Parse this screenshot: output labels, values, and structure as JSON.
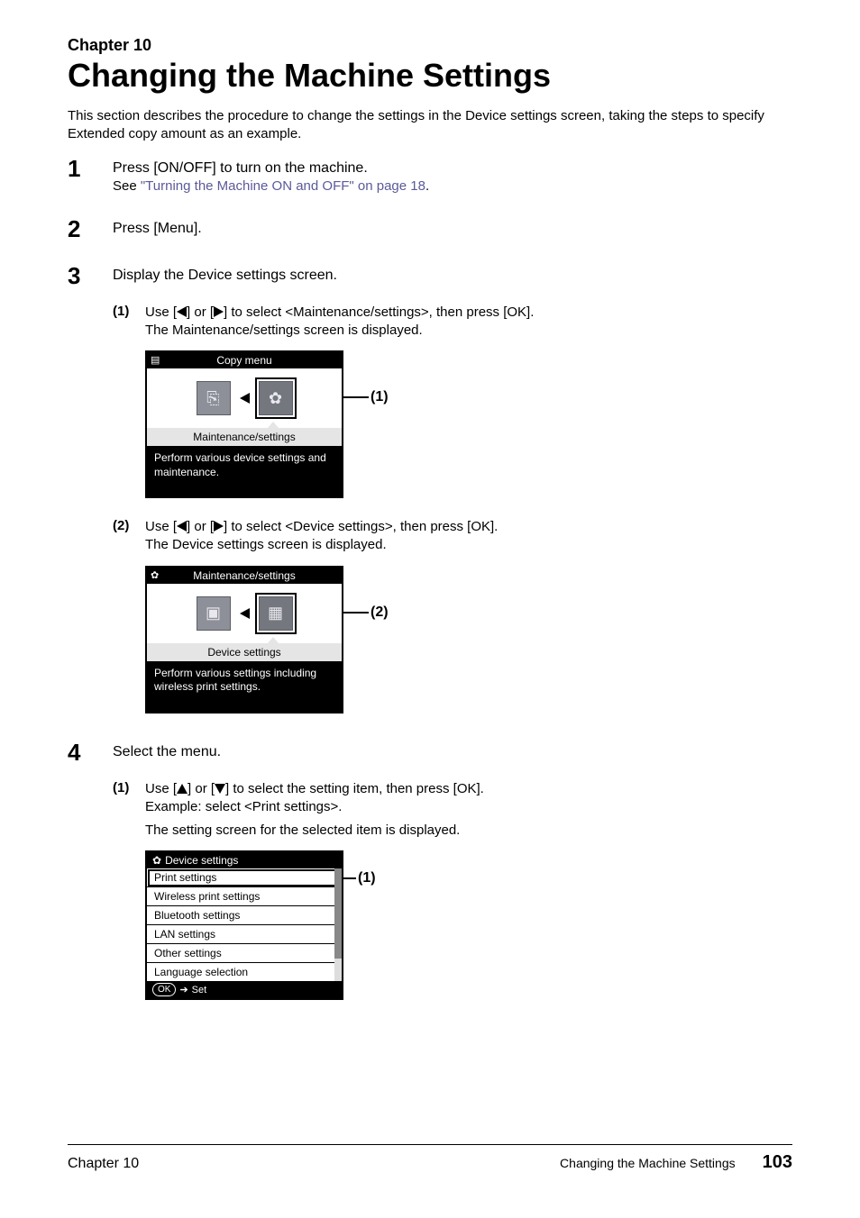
{
  "chapter_label": "Chapter 10",
  "chapter_title": "Changing the Machine Settings",
  "intro": "This section describes the procedure to change the settings in the Device settings screen, taking the steps to specify Extended copy amount as an example.",
  "steps": {
    "s1": {
      "num": "1",
      "title": "Press [ON/OFF] to turn on the machine.",
      "sub_prefix": "See ",
      "sub_link": "\"Turning the Machine ON and OFF\" on page 18",
      "sub_suffix": "."
    },
    "s2": {
      "num": "2",
      "title": "Press [Menu]."
    },
    "s3": {
      "num": "3",
      "title": "Display the Device settings screen.",
      "sub1": {
        "num": "(1)",
        "line_a": "Use [",
        "line_b": "] or [",
        "line_c": "] to select <Maintenance/settings>, then press [OK].",
        "line2": "The Maintenance/settings screen is displayed."
      },
      "lcd1": {
        "header": "Copy menu",
        "sublabel": "Maintenance/settings",
        "desc": "Perform various device settings and maintenance.",
        "callout": "(1)"
      },
      "sub2": {
        "num": "(2)",
        "line_a": "Use [",
        "line_b": "] or [",
        "line_c": "] to select <Device settings>, then press [OK].",
        "line2": "The Device settings screen is displayed."
      },
      "lcd2": {
        "header": "Maintenance/settings",
        "sublabel": "Device settings",
        "desc": "Perform various settings including wireless print settings.",
        "callout": "(2)"
      }
    },
    "s4": {
      "num": "4",
      "title": "Select the menu.",
      "sub1": {
        "num": "(1)",
        "line_a": "Use [",
        "line_b": "] or [",
        "line_c": "] to select the setting item, then press [OK].",
        "line2": "Example: select <Print settings>.",
        "line3": "The setting screen for the selected item is displayed."
      },
      "lcd": {
        "header": "Device settings",
        "items": [
          "Print settings",
          "Wireless print settings",
          "Bluetooth settings",
          "LAN settings",
          "Other settings",
          "Language selection"
        ],
        "footer_ok": "OK",
        "footer_set": "Set",
        "callout": "(1)"
      }
    }
  },
  "footer": {
    "left": "Chapter 10",
    "right_text": "Changing the Machine Settings",
    "page": "103"
  }
}
